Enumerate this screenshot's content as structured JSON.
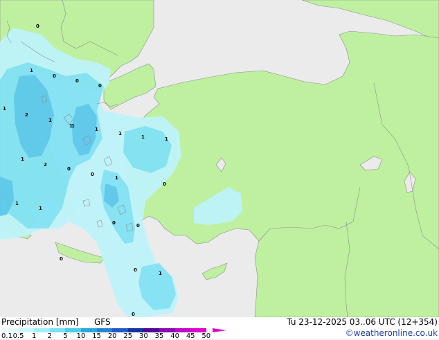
{
  "footer": {
    "title": "Precipitation [mm]",
    "model": "GFS",
    "valid_time": "Tu 23-12-2025 03..06 UTC (12+354)",
    "credit": "©weatheronline.co.uk"
  },
  "colorbar": {
    "ticks": [
      "0.1",
      "0.5",
      "1",
      "2",
      "5",
      "10",
      "15",
      "20",
      "25",
      "30",
      "35",
      "40",
      "45",
      "50"
    ],
    "colors": [
      "#e6fcff",
      "#c8f8ff",
      "#a0f0fa",
      "#78e1f5",
      "#4ccdee",
      "#28a8dc",
      "#2882d2",
      "#1e5ac8",
      "#1432a0",
      "#500096",
      "#8c00b4",
      "#be00c8",
      "#dc00c8"
    ]
  },
  "colors": {
    "sea": "#ebebeb",
    "land": "#bef0a0",
    "border": "#8c8c8c",
    "precip_light": "#bef4fa",
    "precip_mid": "#82e2f4",
    "precip_heavy": "#5cc8ec"
  },
  "map": {
    "point_values": [
      {
        "id": "p1",
        "text": "0"
      },
      {
        "id": "p2",
        "text": "1"
      },
      {
        "id": "p3",
        "text": "0"
      },
      {
        "id": "p4",
        "text": "0"
      },
      {
        "id": "p5",
        "text": "0"
      },
      {
        "id": "p6",
        "text": "1"
      },
      {
        "id": "p7",
        "text": "2"
      },
      {
        "id": "p8",
        "text": "1"
      },
      {
        "id": "p9",
        "text": "1"
      },
      {
        "id": "p10",
        "text": "1"
      },
      {
        "id": "p11",
        "text": "1"
      },
      {
        "id": "p12",
        "text": "1"
      },
      {
        "id": "p13",
        "text": "1"
      },
      {
        "id": "p14",
        "text": "2"
      },
      {
        "id": "p15",
        "text": "0"
      },
      {
        "id": "p16",
        "text": "0"
      },
      {
        "id": "p17",
        "text": "1"
      },
      {
        "id": "p18",
        "text": "0"
      },
      {
        "id": "p19",
        "text": "1"
      },
      {
        "id": "p20",
        "text": "1"
      },
      {
        "id": "p21",
        "text": "1"
      },
      {
        "id": "p22",
        "text": "0"
      },
      {
        "id": "p23",
        "text": "0"
      },
      {
        "id": "p24",
        "text": "0"
      },
      {
        "id": "p25",
        "text": "1"
      },
      {
        "id": "p26",
        "text": "0"
      },
      {
        "id": "p27",
        "text": "0"
      },
      {
        "id": "p28",
        "text": "1"
      }
    ]
  }
}
